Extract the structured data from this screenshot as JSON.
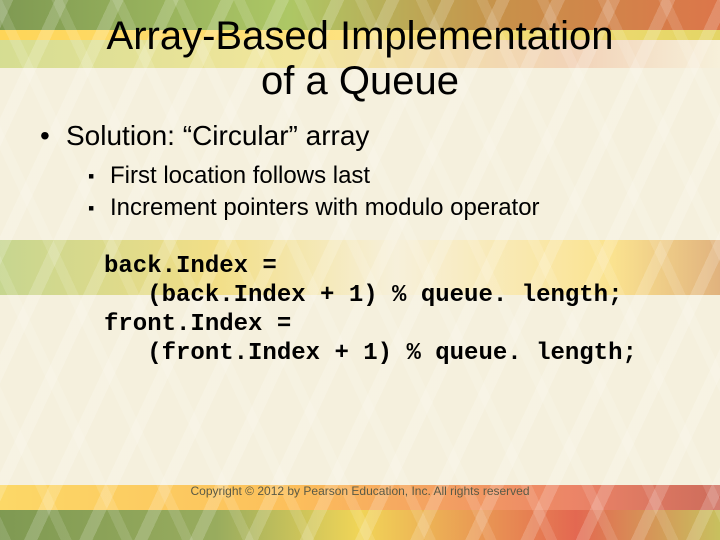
{
  "title_line1": "Array-Based Implementation",
  "title_line2": "of a Queue",
  "bullet1": "Solution: “Circular” array",
  "sub1": "First location follows last",
  "sub2": "Increment pointers with modulo operator",
  "code": "back.Index =\n   (back.Index + 1) % queue. length;\nfront.Index =\n   (front.Index + 1) % queue. length;",
  "copyright": "Copyright © 2012 by Pearson Education, Inc. All rights reserved"
}
